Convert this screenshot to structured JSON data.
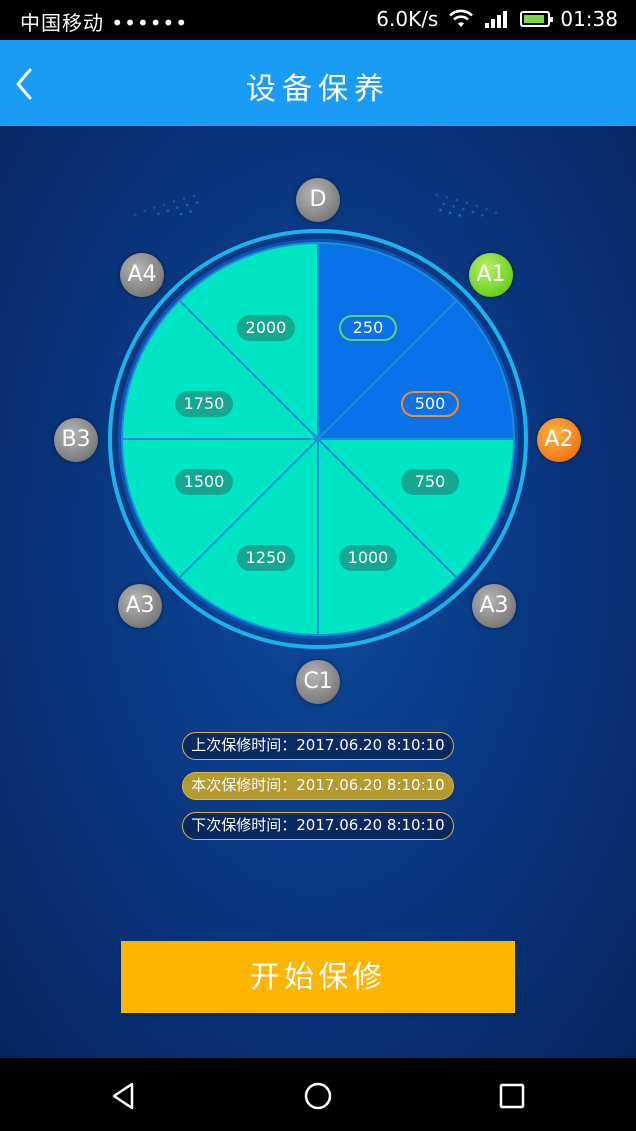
{
  "status_bar": {
    "carrier": "中国移动 ••••••",
    "speed": "6.0K/s",
    "time": "01:38",
    "icons": [
      "wifi-icon",
      "signal-icon",
      "battery-icon"
    ]
  },
  "header": {
    "title": "设备保养",
    "back_icon": "chevron-left-icon"
  },
  "wheel": {
    "nodes": [
      {
        "label": "D",
        "state": "gray"
      },
      {
        "label": "A1",
        "state": "green"
      },
      {
        "label": "A2",
        "state": "orange"
      },
      {
        "label": "A3",
        "state": "gray"
      },
      {
        "label": "C1",
        "state": "gray"
      },
      {
        "label": "A3",
        "state": "gray"
      },
      {
        "label": "B3",
        "state": "gray"
      },
      {
        "label": "A4",
        "state": "gray"
      }
    ],
    "segments": [
      "250",
      "500",
      "750",
      "1000",
      "1250",
      "1500",
      "1750",
      "2000"
    ],
    "colors": {
      "active": "#0a72e8",
      "inactive": "#00e5c4",
      "ring": "#1aa8e8"
    }
  },
  "maintenance_times": {
    "last": "上次保修时间：2017.06.20 8:10:10",
    "current": "本次保修时间：2017.06.20 8:10:10",
    "next": "下次保修时间：2017.06.20 8:10:10"
  },
  "actions": {
    "start_label": "开始保修"
  },
  "nav_bar": {
    "icons": [
      "back-triangle-icon",
      "home-circle-icon",
      "recents-square-icon"
    ]
  }
}
